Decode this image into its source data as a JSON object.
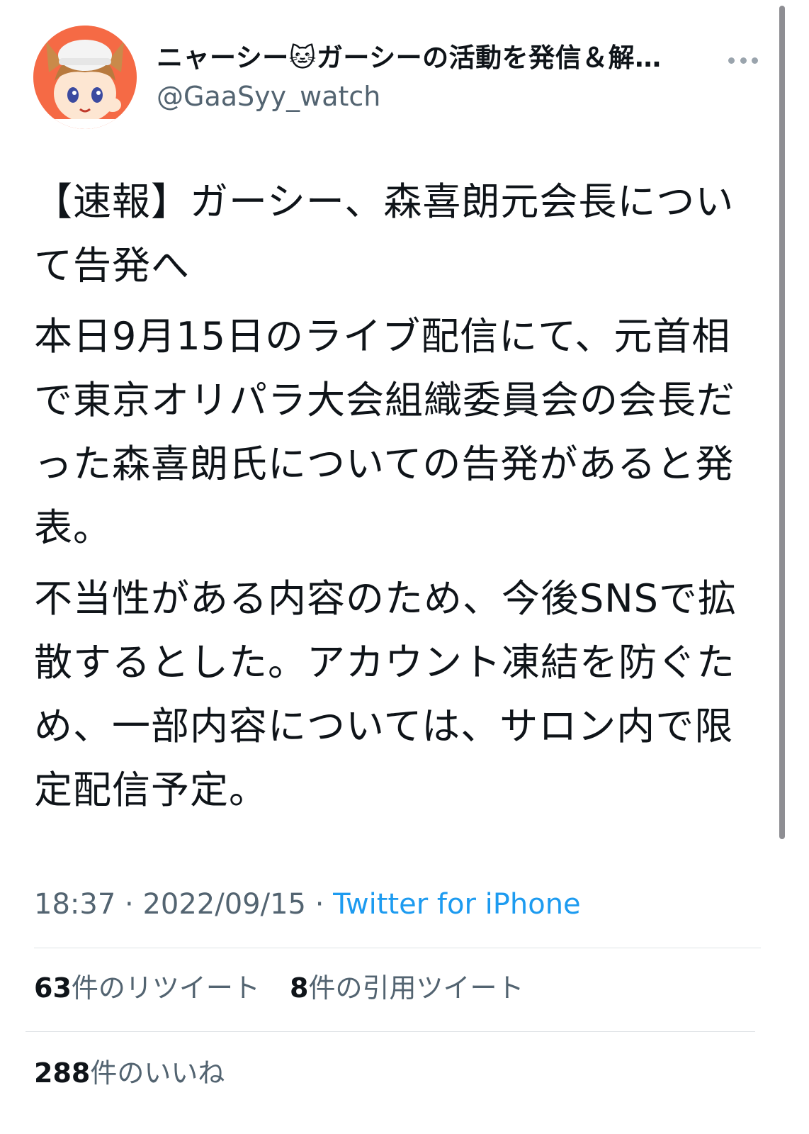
{
  "tweet": {
    "display_name": "ニャーシー🐱ガーシーの活動を発信＆解…",
    "handle": "@GaaSyy_watch",
    "paragraphs": [
      "【速報】ガーシー、森喜朗元会長について告発へ",
      "本日9月15日のライブ配信にて、元首相で東京オリパラ大会組織委員会の会長だった森喜朗氏についての告発があると発表。",
      "不当性がある内容のため、今後SNSで拡散するとした。アカウント凍結を防ぐため、一部内容については、サロン内で限定配信予定。"
    ],
    "time": "18:37",
    "separator": "·",
    "date": "2022/09/15",
    "source": "Twitter for iPhone"
  },
  "stats": {
    "retweets_count": "63",
    "retweets_label": "件のリツイート",
    "quotes_count": "8",
    "quotes_label": "件の引用ツイート",
    "likes_count": "288",
    "likes_label": "件のいいね"
  },
  "icons": {
    "avatar": "anime-boy-cat-ears-avatar",
    "more": "more-dots-icon"
  },
  "colors": {
    "link": "#1d9bf0",
    "secondary_text": "#536471",
    "avatar_bg": "#f56a45"
  }
}
